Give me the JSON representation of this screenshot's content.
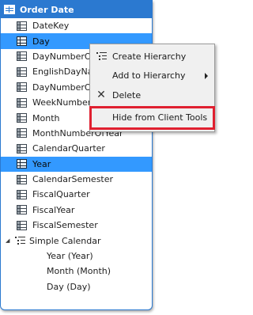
{
  "table": {
    "title": "Order Date",
    "columns": [
      {
        "label": "DateKey",
        "selected": false
      },
      {
        "label": "Day",
        "selected": true
      },
      {
        "label": "DayNumberOf",
        "selected": false
      },
      {
        "label": "EnglishDayNa",
        "selected": false
      },
      {
        "label": "DayNumberOf",
        "selected": false
      },
      {
        "label": "WeekNumberO",
        "selected": false
      },
      {
        "label": "Month",
        "selected": false
      },
      {
        "label": "MonthNumberOfYear",
        "selected": false
      },
      {
        "label": "CalendarQuarter",
        "selected": false
      },
      {
        "label": "Year",
        "selected": true
      },
      {
        "label": "CalendarSemester",
        "selected": false
      },
      {
        "label": "FiscalQuarter",
        "selected": false
      },
      {
        "label": "FiscalYear",
        "selected": false
      },
      {
        "label": "FiscalSemester",
        "selected": false
      }
    ],
    "hierarchy": {
      "expander": "◢",
      "label": "Simple Calendar",
      "levels": [
        "Year (Year)",
        "Month (Month)",
        "Day (Day)"
      ]
    }
  },
  "context_menu": {
    "items": [
      {
        "label": "Create Hierarchy",
        "icon": "hierarchy-icon",
        "has_submenu": false
      },
      {
        "label": "Add to Hierarchy",
        "icon": "",
        "has_submenu": true
      },
      {
        "label": "Delete",
        "icon": "delete-icon",
        "glyph": "✕",
        "has_submenu": false
      },
      {
        "label": "Hide from Client Tools",
        "icon": "",
        "has_submenu": false,
        "highlighted": true
      }
    ]
  },
  "colors": {
    "header_bg": "#2b79d0",
    "selection_bg": "#3399ff",
    "highlight_box": "#e02030",
    "menu_bg": "#f0f0f0"
  }
}
